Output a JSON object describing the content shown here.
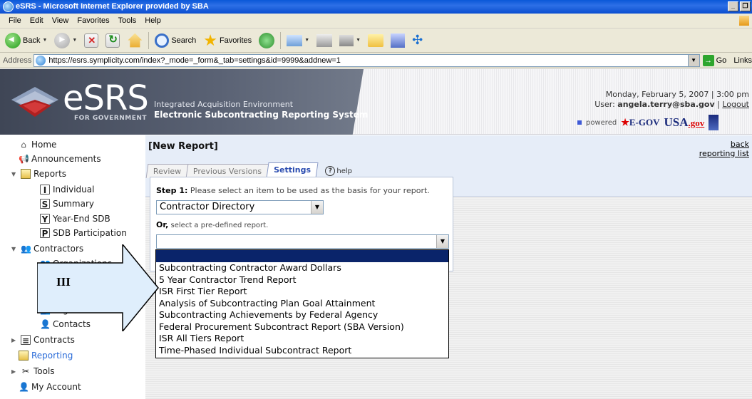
{
  "window": {
    "title": "eSRS - Microsoft Internet Explorer provided by SBA"
  },
  "menu": [
    "File",
    "Edit",
    "View",
    "Favorites",
    "Tools",
    "Help"
  ],
  "toolbar": {
    "back": "Back",
    "search": "Search",
    "favorites": "Favorites"
  },
  "address": {
    "label": "Address",
    "url": "https://esrs.symplicity.com/index?_mode=_form&_tab=settings&id=9999&addnew=1",
    "go": "Go",
    "links": "Links"
  },
  "header": {
    "logo_word": "eSRS",
    "logo_tag": "FOR GOVERNMENT",
    "subtitle1": "Integrated Acquisition Environment",
    "subtitle2": "Electronic Subcontracting Reporting System",
    "datetime": "Monday, February 5, 2007 | 3:00 pm",
    "user_prefix": "User:",
    "user": "angela.terry@sba.gov",
    "logout": "Logout",
    "powered": "powered",
    "egov": "E-GOV",
    "usagov": "USA",
    "usagov_suffix": ".gov"
  },
  "nav": {
    "home": "Home",
    "announcements": "Announcements",
    "reports": "Reports",
    "individual": "Individual",
    "summary": "Summary",
    "year_end_sdb": "Year-End SDB",
    "sdb_participation": "SDB Participation",
    "contractors": "Contractors",
    "organizations": "Organizations",
    "organizations2": "Organizations",
    "contacts": "Contacts",
    "contracts": "Contracts",
    "reporting": "Reporting",
    "tools": "Tools",
    "my_account": "My Account"
  },
  "main": {
    "title": "[New Report]",
    "back": "back",
    "reporting_list": "reporting list",
    "tabs": [
      "Review",
      "Previous Versions",
      "Settings"
    ],
    "help": "help",
    "step1_label": "Step 1:",
    "step1_text": "Please select an item to be used as the basis for your report.",
    "select1_value": "Contractor Directory",
    "or_label": "Or,",
    "or_text": "select a pre-defined report.",
    "select2_value": ""
  },
  "dropdown_options": [
    "Subcontracting Contractor Award Dollars",
    "5 Year Contractor Trend Report",
    "ISR First Tier Report",
    "Analysis of Subcontracting Plan Goal Attainment",
    "Subcontracting Achievements by Federal Agency",
    "Federal Procurement Subcontract Report (SBA Version)",
    "ISR All Tiers Report",
    "Time-Phased Individual Subcontract Report"
  ],
  "callout": {
    "label": "III"
  },
  "colors": {
    "title_bar": "#0a58d8",
    "header_dark": "#3f4656",
    "selected": "#0a246a",
    "nav_active": "#2a6bd8",
    "tab_active": "#2a4cb0"
  }
}
